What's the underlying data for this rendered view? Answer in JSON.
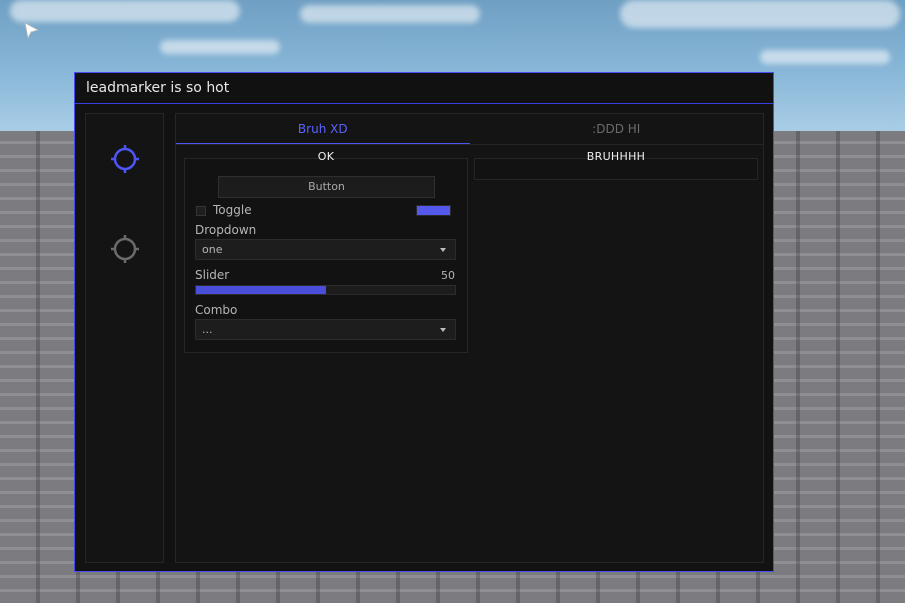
{
  "window": {
    "title": "leadmarker is so hot"
  },
  "sidebar": {
    "items": [
      {
        "icon": "crosshair-icon",
        "active": true
      },
      {
        "icon": "crosshair-icon",
        "active": false
      }
    ]
  },
  "tabs": [
    {
      "label": "Bruh XD",
      "active": true
    },
    {
      "label": ":DDD HI",
      "active": false
    }
  ],
  "left_section": {
    "title": "OK",
    "button_label": "Button",
    "toggle": {
      "label": "Toggle",
      "checked": false,
      "color": "#5558ec"
    },
    "dropdown": {
      "label": "Dropdown",
      "value": "one"
    },
    "slider": {
      "label": "Slider",
      "value": "50",
      "fraction": 0.5
    },
    "combo": {
      "label": "Combo",
      "value": "..."
    }
  },
  "right_section": {
    "title": "BRUHHHH"
  },
  "colors": {
    "accent": "#4f55f5",
    "inactive_icon": "#6a6a6a"
  }
}
